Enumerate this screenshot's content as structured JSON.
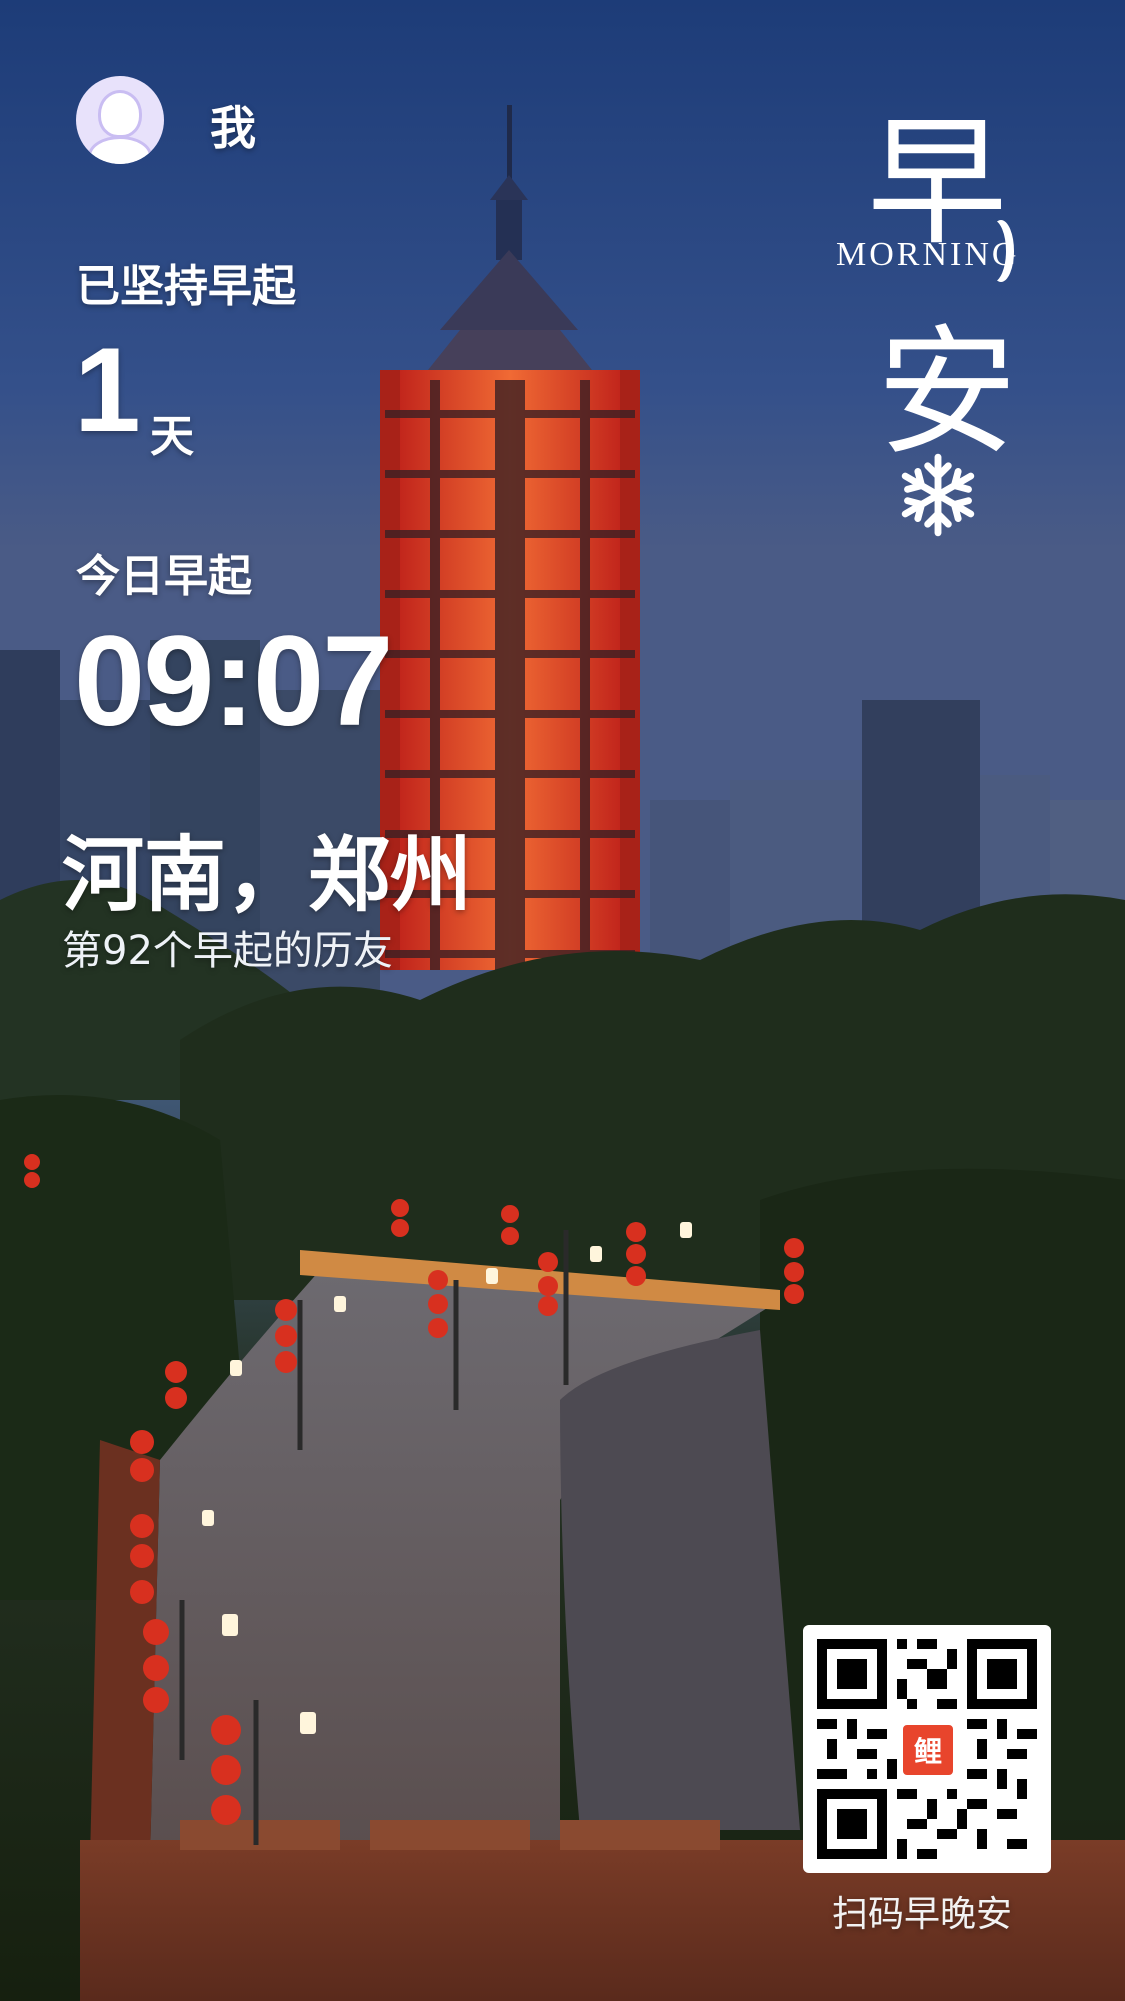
{
  "user": {
    "name": "我"
  },
  "stats": {
    "persist_label": "已坚持早起",
    "days_value": "1",
    "days_unit": "天",
    "today_label": "今日早起",
    "time": "09:07",
    "location": "河南，郑州",
    "rank_text": "第92个早起的历友"
  },
  "greeting": {
    "char_top": "早",
    "subtitle": "MORNING",
    "char_bottom": "安"
  },
  "qr": {
    "logo_text": "鲤",
    "caption": "扫码早晚安"
  },
  "colors": {
    "text": "#ffffff",
    "sky_top": "#1f3f78",
    "pagoda_glow": "#e8452c",
    "lantern": "#d8301f",
    "qr_logo": "#e8452c"
  },
  "icons": {
    "avatar": "user-avatar-icon",
    "moon": "crescent-moon-icon",
    "snowflake": "snowflake-icon",
    "qr": "qr-code-icon"
  }
}
